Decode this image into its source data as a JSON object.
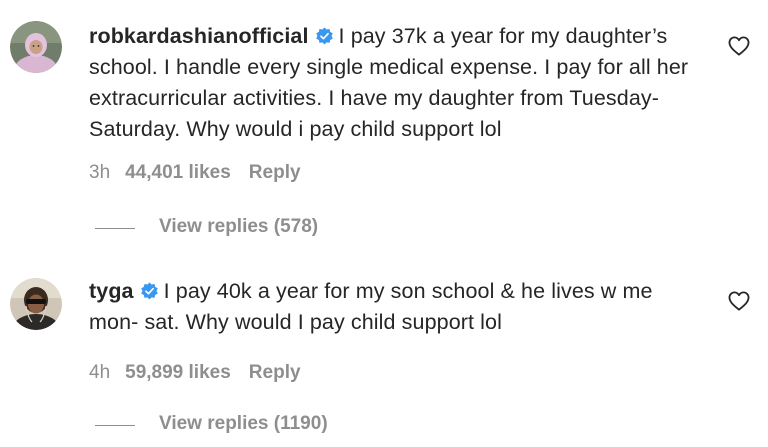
{
  "comments": [
    {
      "username": "robkardashianofficial",
      "verified_icon": "verified-badge-icon",
      "text": "I pay 37k a year for my daughter’s school. I handle every single medical expense. I pay for all her extracurricular activities. I have my daughter from Tuesday-Saturday. Why would i pay child support lol",
      "time": "3h",
      "likes": "44,401 likes",
      "reply_label": "Reply",
      "view_replies": "View replies (578)",
      "like_icon": "heart-outline-icon"
    },
    {
      "username": "tyga",
      "verified_icon": "verified-badge-icon",
      "text": "I pay 40k a year for my son school & he lives w me mon- sat. Why would I pay child support lol",
      "time": "4h",
      "likes": "59,899 likes",
      "reply_label": "Reply",
      "view_replies": "View replies (1190)",
      "like_icon": "heart-outline-icon"
    }
  ],
  "colors": {
    "text_primary": "#262626",
    "text_secondary": "#8e8e8e",
    "verified_blue": "#3897f0",
    "background": "#ffffff"
  }
}
